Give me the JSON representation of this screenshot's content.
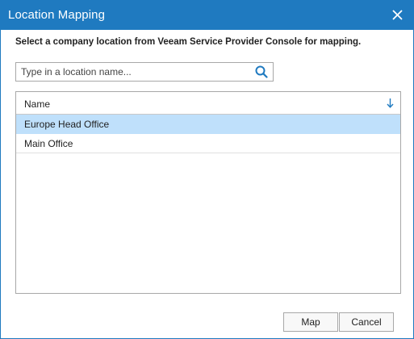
{
  "dialog": {
    "title": "Location Mapping",
    "instruction": "Select a company location from Veeam Service Provider Console for mapping."
  },
  "search": {
    "placeholder": "Type in a location name...",
    "value": ""
  },
  "grid": {
    "columns": [
      {
        "label": "Name",
        "sort": "descending"
      }
    ],
    "rows": [
      {
        "name": "Europe Head Office",
        "selected": true
      },
      {
        "name": "Main Office",
        "selected": false
      }
    ]
  },
  "buttons": {
    "map_label": "Map",
    "cancel_label": "Cancel"
  },
  "colors": {
    "titlebar": "#1f7ac0",
    "selection": "#bfe0fb",
    "icon_accent": "#1f7ac0"
  },
  "icons": {
    "close": "close-icon",
    "search": "search-icon",
    "sort": "sort-down-arrow-icon"
  }
}
